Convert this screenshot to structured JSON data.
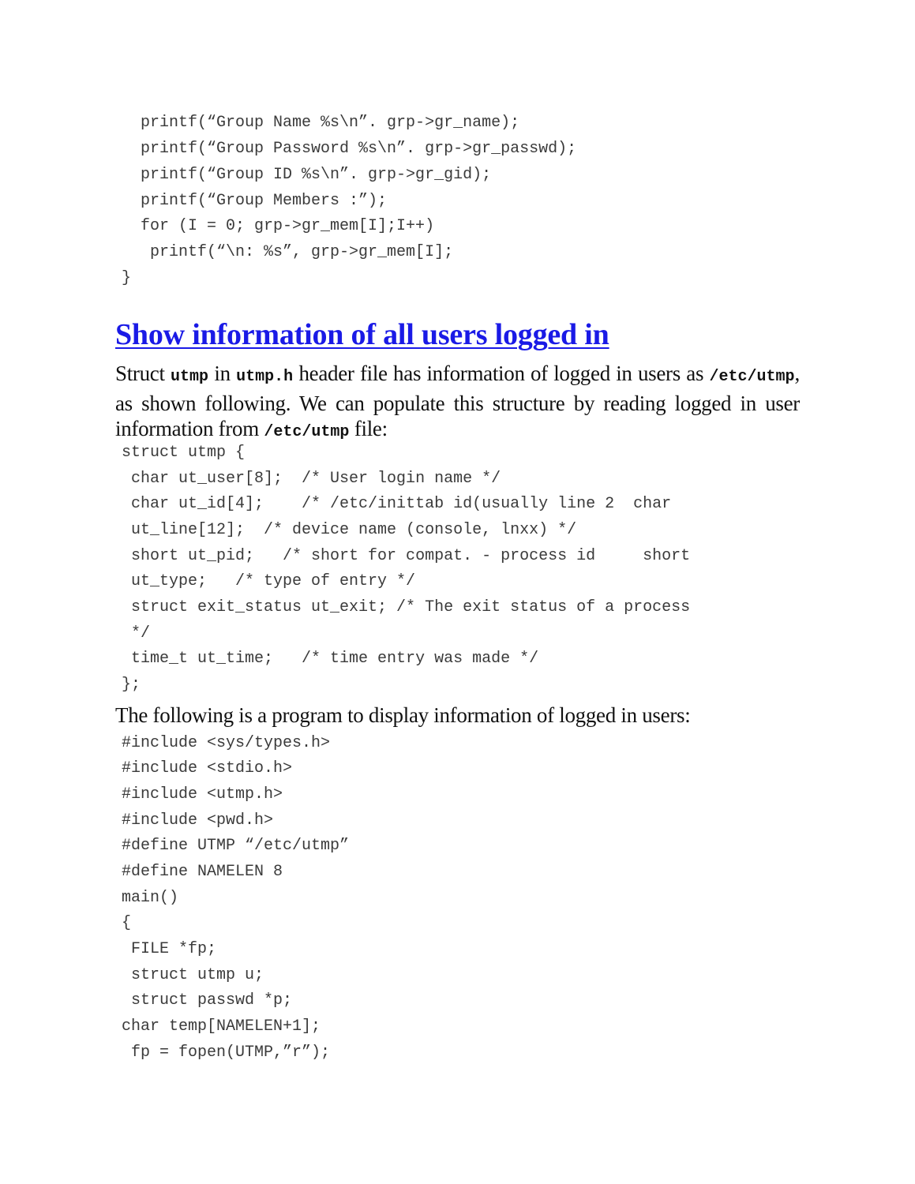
{
  "code_top": {
    "lines": [
      "  printf(“Group Name %s\\n”. grp->gr_name);",
      "  printf(“Group Password %s\\n”. grp->gr_passwd);",
      "  printf(“Group ID %s\\n”. grp->gr_gid);",
      "  printf(“Group Members :”);",
      "  for (I = 0; grp->gr_mem[I];I++)",
      "   printf(“\\n: %s”, grp->gr_mem[I];",
      "}"
    ]
  },
  "section": {
    "heading": "Show information of all users logged in",
    "intro": {
      "t1": "Struct ",
      "c1": "utmp",
      "t2": " in ",
      "c2": "utmp.h",
      "t3": " header file has information of logged in users as ",
      "c3": "/etc/utmp",
      "t4": ", as shown following. We can populate this structure by reading logged in user information from ",
      "c4": "/etc/utmp",
      "t5": " file:"
    },
    "struct_code": {
      "lines": [
        " struct utmp {",
        "  char ut_user[8];  /* User login name */",
        "  char ut_id[4];    /* /etc/inittab id(usually line 2  char",
        "  ut_line[12];  /* device name (console, lnxx) */",
        "  short ut_pid;   /* short for compat. - process id     short",
        "  ut_type;   /* type of entry */",
        "  struct exit_status ut_exit; /* The exit status of a process",
        "  */",
        "  time_t ut_time;   /* time entry was made */",
        " };"
      ]
    },
    "program_intro": "The following is a program to display information of logged in users:",
    "program_code": {
      "lines": [
        " #include <sys/types.h>",
        " #include <stdio.h>",
        " #include <utmp.h>",
        " #include <pwd.h>",
        " #define UTMP “/etc/utmp”",
        " #define NAMELEN 8",
        " main()",
        " {",
        "  FILE *fp;",
        "  struct utmp u;",
        "  struct passwd *p;",
        " char temp[NAMELEN+1];",
        "  fp = fopen(UTMP,”r”);"
      ]
    }
  }
}
